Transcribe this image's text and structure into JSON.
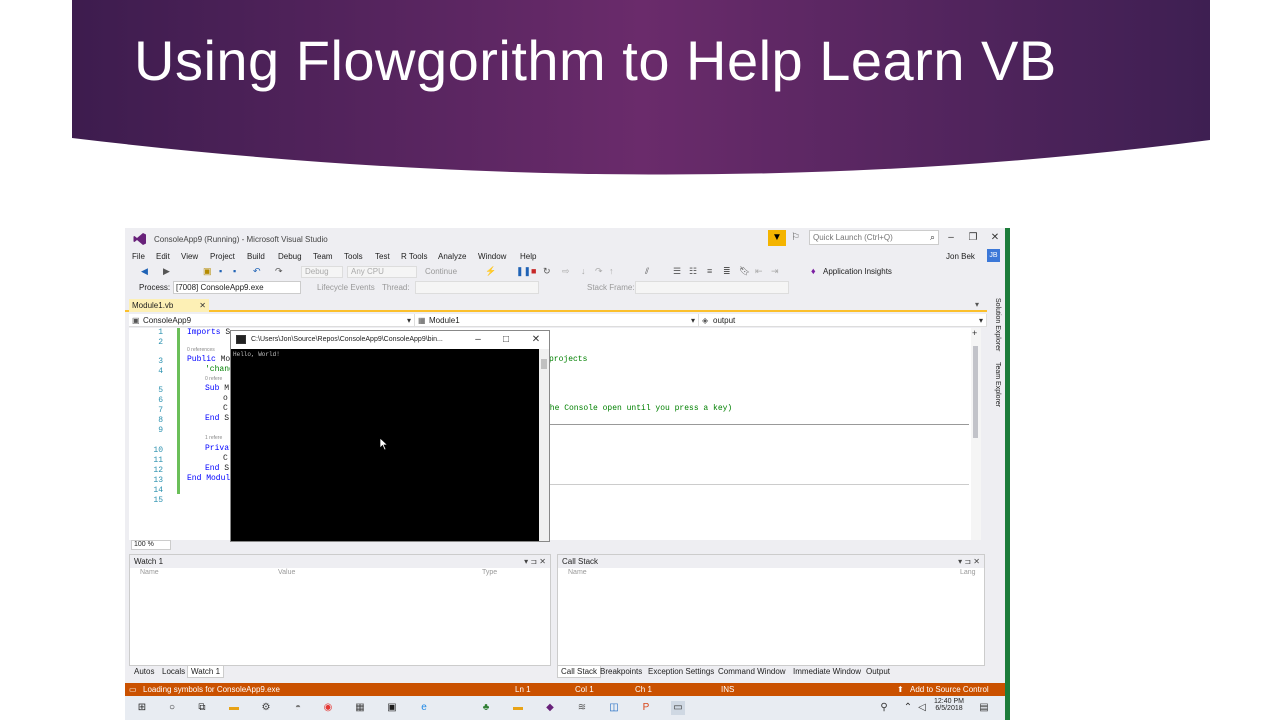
{
  "slide": {
    "title": "Using Flowgorithm to Help Learn VB"
  },
  "window": {
    "title": "ConsoleApp9 (Running) - Microsoft Visual Studio",
    "quick_launch_placeholder": "Quick Launch (Ctrl+Q)",
    "user_name": "Jon Bek",
    "user_initials": "JB"
  },
  "menu": [
    "File",
    "Edit",
    "View",
    "Project",
    "Build",
    "Debug",
    "Team",
    "Tools",
    "Test",
    "R Tools",
    "Analyze",
    "Window",
    "Help"
  ],
  "toolbar": {
    "config": "Debug",
    "platform": "Any CPU",
    "continue_label": "Continue",
    "app_insights": "Application Insights"
  },
  "debug_location": {
    "process_label": "Process:",
    "process_value": "[7008] ConsoleApp9.exe",
    "lifecycle_label": "Lifecycle Events",
    "thread_label": "Thread:",
    "stack_frame_label": "Stack Frame:"
  },
  "tabs": {
    "active": "Module1.vb"
  },
  "navbar": {
    "project": "ConsoleApp9",
    "type": "Module1",
    "member": "output"
  },
  "editor": {
    "line_numbers": [
      "1",
      "2",
      "3",
      "4",
      "5",
      "6",
      "7",
      "8",
      "9",
      "10",
      "11",
      "12",
      "13",
      "14",
      "15"
    ],
    "imports_kw": "Imports",
    "imports_rest": " S",
    "hint_refs0a": "0 references",
    "public_kw": "Public",
    "public_rest": " Mo",
    "comment_change": "'chang",
    "hint_refs0b": "0 refere",
    "sub_kw": "Sub",
    "sub_rest": " M",
    "line6": "o",
    "line7": "C",
    "end_sub1_kw": "End",
    "end_sub1_rest": " S",
    "hint_refs1": "1 refere",
    "private_kw": "Privat",
    "line11": "C",
    "end_sub2_kw": "End",
    "end_sub2_rest": " S",
    "end_module": "End Module",
    "right_comment1": "projects",
    "right_comment2": "the Console open until you press a key)",
    "zoom": "100 %"
  },
  "console_window": {
    "title": "C:\\Users\\Jon\\Source\\Repos\\ConsoleApp9\\ConsoleApp9\\bin...",
    "output": "Hello, World!"
  },
  "watch_panel": {
    "title": "Watch 1",
    "columns": [
      "Name",
      "Value",
      "Type"
    ],
    "tabs": [
      "Autos",
      "Locals",
      "Watch 1"
    ]
  },
  "callstack_panel": {
    "title": "Call Stack",
    "columns": [
      "Name",
      "Lang"
    ],
    "tabs": [
      "Call Stack",
      "Breakpoints",
      "Exception Settings",
      "Command Window",
      "Immediate Window",
      "Output"
    ]
  },
  "side_tabs": [
    "Solution Explorer",
    "Team Explorer"
  ],
  "status": {
    "message": "Loading symbols for ConsoleApp9.exe",
    "line": "Ln 1",
    "col": "Col 1",
    "ch": "Ch 1",
    "mode": "INS",
    "source_control": "Add to Source Control"
  },
  "taskbar": {
    "time": "12:40 PM",
    "date": "6/5/2018"
  },
  "colors": {
    "banner_dark": "#3a1a4a",
    "banner_mid": "#6b2c6a",
    "status_orange": "#ca5100",
    "accent_yellow": "#fbc02d"
  }
}
